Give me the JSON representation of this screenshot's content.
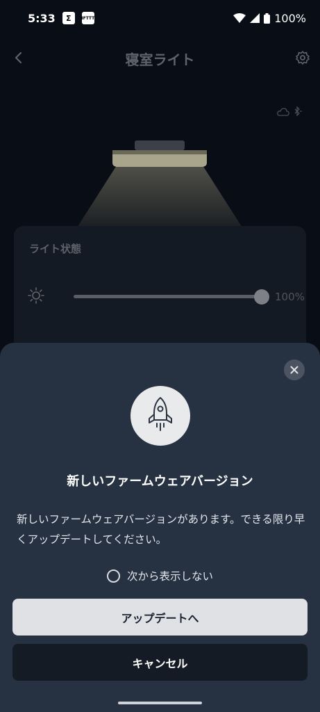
{
  "status_bar": {
    "time": "5:33",
    "notif_icons": [
      "Σ",
      "IFTTT"
    ],
    "battery": "100%"
  },
  "app": {
    "title": "寝室ライト",
    "card_title": "ライト状態",
    "brightness": {
      "value": 1.0,
      "label": "100%"
    }
  },
  "dialog": {
    "title": "新しいファームウェアバージョン",
    "message": "新しいファームウェアバージョンがあります。できる限り早くアップデートしてください。",
    "dont_show_label": "次から表示しない",
    "update_label": "アップデートへ",
    "cancel_label": "キャンセル"
  },
  "icons": [
    "back-icon",
    "gear-icon",
    "cloud-icon",
    "bluetooth-icon",
    "sun-icon",
    "close-icon",
    "rocket-icon"
  ]
}
